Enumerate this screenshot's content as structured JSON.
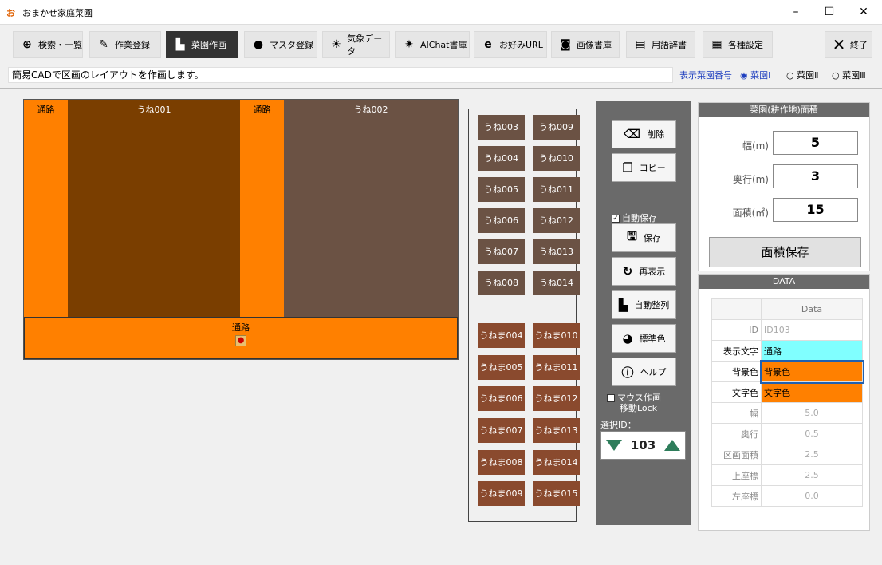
{
  "window": {
    "title": "おまかせ家庭菜園",
    "controls": [
      "–",
      "☐",
      "✕"
    ]
  },
  "toolbar": {
    "buttons": [
      {
        "label": "検索・一覧",
        "icon": "search-icon"
      },
      {
        "label": "作業登録",
        "icon": "edit-icon"
      },
      {
        "label": "菜園作画",
        "icon": "ruler-icon"
      },
      {
        "label": "マスタ登録",
        "icon": "person-icon"
      },
      {
        "label": "気象データ",
        "icon": "sun-icon"
      },
      {
        "label": "AIChat書庫",
        "icon": "ai-icon"
      },
      {
        "label": "お好みURL",
        "icon": "browser-icon"
      },
      {
        "label": "画像書庫",
        "icon": "camera-icon"
      },
      {
        "label": "用語辞書",
        "icon": "book-icon"
      },
      {
        "label": "各種設定",
        "icon": "grid-icon"
      },
      {
        "label": "終了",
        "icon": "close-icon"
      }
    ]
  },
  "message": "簡易CADで区画のレイアウトを作画します。",
  "garden_select": {
    "label": "表示菜園番号",
    "options": [
      "菜園Ⅰ",
      "菜園Ⅱ",
      "菜園Ⅲ"
    ],
    "selected": "菜園Ⅰ"
  },
  "canvas": {
    "plots": [
      {
        "label": "通路",
        "color": "#ff8000"
      },
      {
        "label": "うね001",
        "color": "#7a3e00"
      },
      {
        "label": "通路",
        "color": "#ff8000"
      },
      {
        "label": "うね002",
        "color": "#6b5244"
      },
      {
        "label": "通路",
        "color": "#ff8000"
      }
    ]
  },
  "palette": {
    "une_left": [
      "うね003",
      "うね004",
      "うね005",
      "うね006",
      "うね007",
      "うね008"
    ],
    "une_right": [
      "うね009",
      "うね010",
      "うね011",
      "うね012",
      "うね013",
      "うね014"
    ],
    "unema_left": [
      "うねま004",
      "うねま005",
      "うねま006",
      "うねま007",
      "うねま008",
      "うねま009"
    ],
    "unema_right": [
      "うねま010",
      "うねま011",
      "うねま012",
      "うねま013",
      "うねま014",
      "うねま015"
    ]
  },
  "tools": {
    "delete": "削除",
    "copy": "コピー",
    "autosave": "自動保存",
    "save": "保存",
    "refresh": "再表示",
    "auto_arrange": "自動整列",
    "default_color": "標準色",
    "help": "ヘルプ",
    "mouse_lock_line1": "マウス作画",
    "mouse_lock_line2": "移動Lock",
    "selected_id_label": "選択ID：",
    "selected_id": "103"
  },
  "area": {
    "header": "菜園(耕作地)面積",
    "width_label": "幅(m)",
    "width": "5",
    "depth_label": "奥行(m)",
    "depth": "3",
    "area_label": "面積(㎡)",
    "area": "15",
    "save_button": "面積保存"
  },
  "data": {
    "header": "DATA",
    "column": "Data",
    "rows": [
      {
        "key": "ID",
        "value": "ID103"
      },
      {
        "key": "表示文字",
        "value": "通路",
        "bg": "#80ffff"
      },
      {
        "key": "背景色",
        "value": "背景色",
        "bg": "#ff8000"
      },
      {
        "key": "文字色",
        "value": "文字色",
        "bg": "#ff8000"
      },
      {
        "key": "幅",
        "value": "5.0"
      },
      {
        "key": "奥行",
        "value": "0.5"
      },
      {
        "key": "区画面積",
        "value": "2.5"
      },
      {
        "key": "上座標",
        "value": "2.5"
      },
      {
        "key": "左座標",
        "value": "0.0"
      }
    ]
  }
}
